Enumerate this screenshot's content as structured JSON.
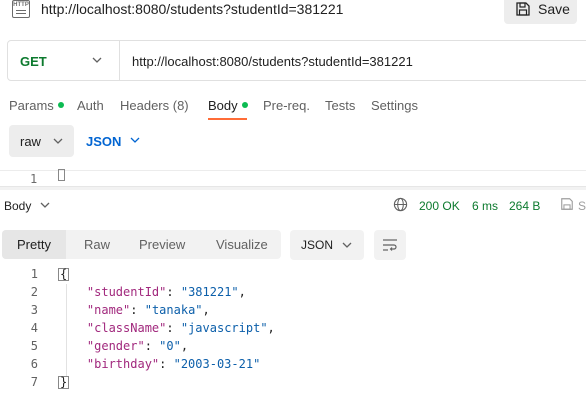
{
  "header": {
    "icon_text": "HTTP",
    "title": "http://localhost:8080/students?studentId=381221",
    "save_label": "Save"
  },
  "request": {
    "method": "GET",
    "url": "http://localhost:8080/students?studentId=381221",
    "tabs": [
      {
        "label": "Params",
        "dot": true
      },
      {
        "label": "Auth",
        "dot": false
      },
      {
        "label": "Headers (8)",
        "dot": false
      },
      {
        "label": "Body",
        "dot": true,
        "active": true
      },
      {
        "label": "Pre-req.",
        "dot": false
      },
      {
        "label": "Tests",
        "dot": false
      },
      {
        "label": "Settings",
        "dot": false
      }
    ],
    "body_mode": "raw",
    "body_language": "JSON",
    "editor_line": "1"
  },
  "response": {
    "section_label": "Body",
    "status": "200 OK",
    "time": "6 ms",
    "size": "264 B",
    "save_label_partial": "S",
    "view_tabs": [
      "Pretty",
      "Raw",
      "Preview",
      "Visualize"
    ],
    "active_view": "Pretty",
    "format": "JSON",
    "lines": [
      {
        "n": "1",
        "brace": "{"
      },
      {
        "n": "2",
        "key": "\"studentId\"",
        "value": "\"381221\"",
        "comma": ","
      },
      {
        "n": "3",
        "key": "\"name\"",
        "value": "\"tanaka\"",
        "comma": ","
      },
      {
        "n": "4",
        "key": "\"className\"",
        "value": "\"javascript\"",
        "comma": ","
      },
      {
        "n": "5",
        "key": "\"gender\"",
        "value": "\"0\"",
        "comma": ","
      },
      {
        "n": "6",
        "key": "\"birthday\"",
        "value": "\"2003-03-21\"",
        "comma": ""
      },
      {
        "n": "7",
        "brace": "}"
      }
    ]
  },
  "colors": {
    "accent": "#ff6c37",
    "method_get": "#0c7a2e",
    "status_ok": "#0c7a2e",
    "json_key": "#a1287d",
    "json_string": "#0c5faa",
    "link_blue": "#0265d2"
  }
}
